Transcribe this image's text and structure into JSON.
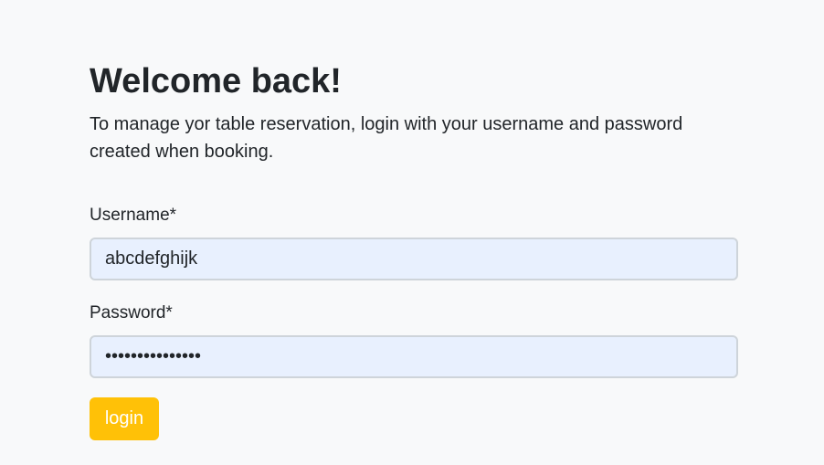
{
  "page": {
    "title": "Welcome back!",
    "subtitle": "To manage yor table reservation, login with your username and password created when booking."
  },
  "form": {
    "username_label": "Username*",
    "username_value": "abcdefghijk",
    "password_label": "Password*",
    "password_value": "passwordpasswor",
    "login_label": "login"
  },
  "colors": {
    "background": "#f8f9fa",
    "input_fill": "#e8f0fe",
    "button": "#ffc107",
    "button_text": "#ffffff"
  }
}
